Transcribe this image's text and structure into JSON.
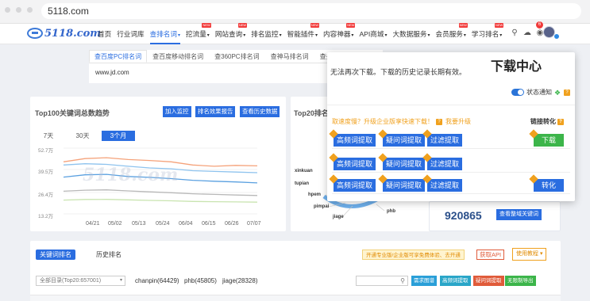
{
  "browser": {
    "url": "5118.com"
  },
  "nav": {
    "logo": "5118.com",
    "items": [
      {
        "label": "首页",
        "caret": false,
        "new": false
      },
      {
        "label": "行业词库",
        "caret": false,
        "new": false
      },
      {
        "label": "查排名词",
        "caret": true,
        "new": false,
        "active": true
      },
      {
        "label": "挖流量",
        "caret": true,
        "new": true
      },
      {
        "label": "网站查询",
        "caret": true,
        "new": true
      },
      {
        "label": "排名监控",
        "caret": true,
        "new": false
      },
      {
        "label": "智能插件",
        "caret": true,
        "new": true
      },
      {
        "label": "内容神器",
        "caret": true,
        "new": true
      },
      {
        "label": "API商城",
        "caret": true,
        "new": false
      },
      {
        "label": "大数据服务",
        "caret": true,
        "new": false
      },
      {
        "label": "会员服务",
        "caret": true,
        "new": true
      },
      {
        "label": "学习排名",
        "caret": true,
        "new": true
      }
    ],
    "new_tag": "NEW",
    "bell_count": "6"
  },
  "search": {
    "tabs": [
      "查百度PC排名词",
      "查百度移动排名词",
      "查360PC排名词",
      "查神马排名词",
      "查头条排名词"
    ],
    "value": "www.jd.com"
  },
  "popup": {
    "title": "下载中心",
    "message": "无法再次下载。下载的历史记录长期有效。",
    "toggle_label": "状态通知",
    "upgrade_text": "取速度慢？升级企业版享快速下载！",
    "upgrade_link": "我要升级",
    "column_header": "链接转化",
    "rows": [
      {
        "buttons": [
          "高频词提取",
          "疑问词提取",
          "过滤提取"
        ],
        "action": "下载",
        "action_color": "green"
      },
      {
        "buttons": [
          "高频词提取",
          "疑问词提取",
          "过滤提取"
        ],
        "action": "",
        "action_color": ""
      },
      {
        "buttons": [
          "高频词提取",
          "疑问词提取",
          "过滤提取"
        ],
        "action": "转化",
        "action_color": "blue"
      }
    ]
  },
  "trend": {
    "title": "Top100关键词总数趋势",
    "buttons": [
      "加入监控",
      "排名效果报告",
      "查看历史数据"
    ],
    "ranges": [
      "7天",
      "30天",
      "3个月"
    ],
    "active_range": "3个月"
  },
  "chart_data": {
    "type": "line",
    "title": "",
    "xlabel": "",
    "ylabel": "",
    "y_ticks": [
      "52.7万",
      "39.5万",
      "26.4万",
      "13.2万"
    ],
    "x": [
      "04/21",
      "05/02",
      "05/13",
      "05/24",
      "06/04",
      "06/15",
      "06/26",
      "07/07"
    ],
    "ylim": [
      0,
      527000
    ],
    "series": [
      {
        "color": "#f5a27a",
        "values": [
          420000,
          445000,
          452000,
          438000,
          430000,
          420000,
          395000,
          385000,
          392000,
          388000
        ]
      },
      {
        "color": "#8ec3ee",
        "values": [
          395000,
          405000,
          400000,
          385000,
          372000,
          365000,
          350000,
          345000,
          340000,
          335000
        ]
      },
      {
        "color": "#5aa0e0",
        "values": [
          300000,
          318000,
          322000,
          305000,
          298000,
          288000,
          275000,
          268000,
          262000,
          255000
        ]
      },
      {
        "color": "#b8b8b8",
        "values": [
          190000,
          198000,
          200000,
          192000,
          185000,
          178000,
          170000,
          165000,
          160000,
          156000
        ]
      },
      {
        "color": "#c9e4b0",
        "values": [
          120000,
          125000,
          126000,
          122000,
          118000,
          115000,
          110000,
          108000,
          106000,
          104000
        ]
      }
    ]
  },
  "top20": {
    "title": "Top20排名",
    "keywords": [
      "xinkuan",
      "tupian",
      "hpem",
      "pimpai",
      "jiage",
      "phb"
    ],
    "total": "920865",
    "view_button": "查看整域关键词"
  },
  "bottom": {
    "tabs": [
      "关键词排名",
      "历史排名"
    ],
    "promo": "开通专业版/企业版可享免费体验、去开通",
    "api_button": "获取API",
    "guide_button": "使用教程",
    "select_value": "全部目录(Top20:657001)",
    "keyword_tags": [
      "chanpin(64429)",
      "phb(45805)",
      "jiage(28328)"
    ],
    "actions": [
      {
        "label": "需求图谱",
        "color": "#2a9fd8"
      },
      {
        "label": "高频词提取",
        "color": "#2aa6c8"
      },
      {
        "label": "疑问词提取",
        "color": "#e05b3a"
      },
      {
        "label": "无限制导出",
        "color": "#3cb54a"
      }
    ]
  }
}
